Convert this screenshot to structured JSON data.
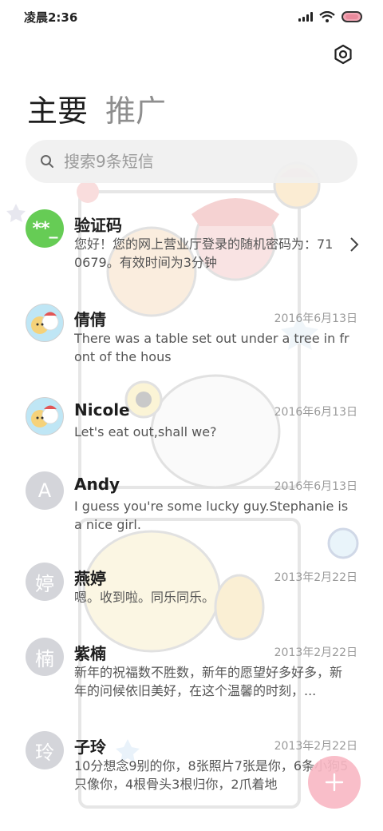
{
  "status_bar": {
    "time": "凌晨2:36"
  },
  "header": {
    "settings_icon": "gear-icon",
    "tabs": [
      {
        "label": "主要",
        "active": true
      },
      {
        "label": "推广",
        "active": false
      }
    ]
  },
  "search": {
    "placeholder": "搜索9条短信",
    "icon": "search-icon"
  },
  "conversations": [
    {
      "name": "验证码",
      "avatar_text": "**_",
      "avatar_style": "green",
      "date": "",
      "preview": "您好！您的网上营业厅登录的随机密码为：710679。有效时间为3分钟",
      "has_chevron": true
    },
    {
      "name": "倩倩",
      "avatar_style": "picture",
      "date": "2016年6月13日",
      "preview": "There was a table set out under a tree in front of the hous"
    },
    {
      "name": "Nicole",
      "avatar_style": "picture",
      "date": "2016年6月13日",
      "preview": "Let's eat out,shall we?"
    },
    {
      "name": "Andy",
      "avatar_text": "A",
      "avatar_style": "grey",
      "date": "2016年6月13日",
      "preview": "I guess you're some lucky guy.Stephanie is a nice girl."
    },
    {
      "name": "燕婷",
      "avatar_text": "婷",
      "avatar_style": "grey",
      "date": "2013年2月22日",
      "preview": "嗯。收到啦。同乐同乐。"
    },
    {
      "name": "紫楠",
      "avatar_text": "楠",
      "avatar_style": "grey",
      "date": "2013年2月22日",
      "preview": "新年的祝福数不胜数，新年的愿望好多好多，新年的问候依旧美好，在这个温馨的时刻，..."
    },
    {
      "name": "子玲",
      "avatar_text": "玲",
      "avatar_style": "grey",
      "date": "2013年2月22日",
      "preview": "10分想念9别的你，8张照片7张是你，6条小狗5只像你，4根骨头3根归你，2爪着地"
    }
  ],
  "fab": {
    "icon": "plus-icon",
    "color": "#f8b9c4"
  },
  "colors": {
    "accent_green": "#66cc55",
    "grey_avatar": "#d4d5da",
    "date_text": "#9a9a9a"
  }
}
